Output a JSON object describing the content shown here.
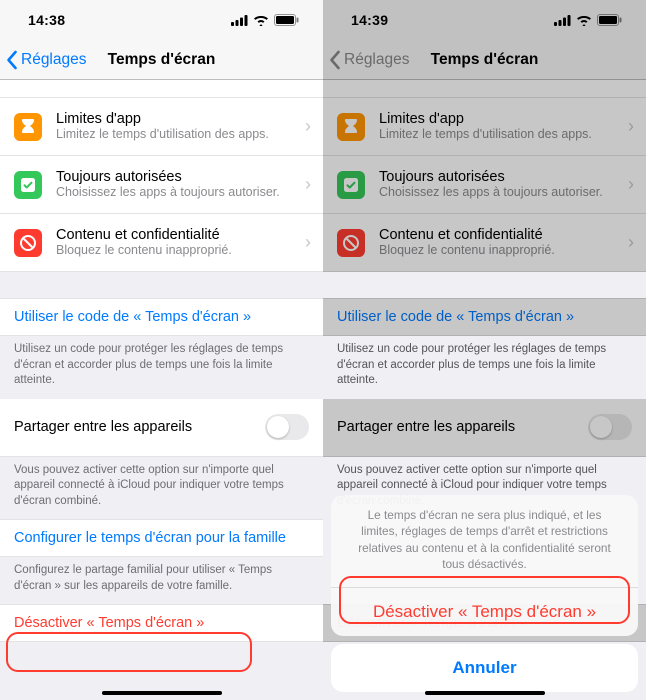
{
  "left": {
    "status": {
      "time": "14:38"
    },
    "nav": {
      "back": "Réglages",
      "title": "Temps d'écran"
    },
    "rows": {
      "limites": {
        "title": "Limites d'app",
        "sub": "Limitez le temps d'utilisation des apps."
      },
      "toujours": {
        "title": "Toujours autorisées",
        "sub": "Choisissez les apps à toujours autoriser."
      },
      "contenu": {
        "title": "Contenu et confidentialité",
        "sub": "Bloquez le contenu inapproprié."
      }
    },
    "code_link": "Utiliser le code de « Temps d'écran »",
    "code_footer": "Utilisez un code pour protéger les réglages de temps d'écran et accorder plus de temps une fois la limite atteinte.",
    "share_row": "Partager entre les appareils",
    "share_footer": "Vous pouvez activer cette option sur n'importe quel appareil connecté à iCloud pour indiquer votre temps d'écran combiné.",
    "family_link": "Configurer le temps d'écran pour la famille",
    "family_footer": "Configurez le partage familial pour utiliser « Temps d'écran » sur les appareils de votre famille.",
    "disable": "Désactiver « Temps d'écran »"
  },
  "right": {
    "status": {
      "time": "14:39"
    },
    "nav": {
      "back": "Réglages",
      "title": "Temps d'écran"
    },
    "sheet": {
      "message": "Le temps d'écran ne sera plus indiqué, et les limites, réglages de temps d'arrêt et restrictions relatives au contenu et à la confidentialité seront tous désactivés.",
      "action": "Désactiver « Temps d'écran »",
      "cancel": "Annuler"
    }
  }
}
